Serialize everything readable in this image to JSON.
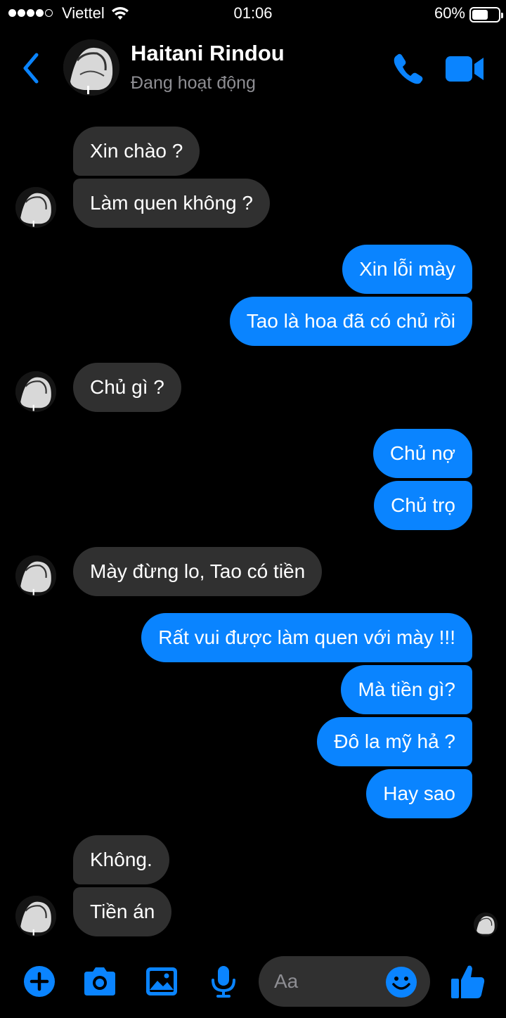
{
  "status_bar": {
    "carrier": "Viettel",
    "time": "01:06",
    "battery_percent": "60%",
    "battery_level": 0.6
  },
  "header": {
    "contact_name": "Haitani Rindou",
    "contact_status": "Đang hoạt động",
    "icons": [
      "back-chevron-icon",
      "phone-icon",
      "video-camera-icon"
    ]
  },
  "messages": [
    {
      "sender": "them",
      "text": "Xin chào ?"
    },
    {
      "sender": "them",
      "text": "Làm quen không ?"
    },
    {
      "sender": "me",
      "text": "Xin lỗi mày"
    },
    {
      "sender": "me",
      "text": "Tao là hoa đã có chủ rồi"
    },
    {
      "sender": "them",
      "text": "Chủ gì ?"
    },
    {
      "sender": "me",
      "text": "Chủ nợ"
    },
    {
      "sender": "me",
      "text": "Chủ trọ"
    },
    {
      "sender": "them",
      "text": "Mày đừng lo, Tao có tiền"
    },
    {
      "sender": "me",
      "text": "Rất vui được làm quen với mày !!!"
    },
    {
      "sender": "me",
      "text": "Mà tiền gì?"
    },
    {
      "sender": "me",
      "text": "Đô la mỹ hả ?"
    },
    {
      "sender": "me",
      "text": "Hay sao"
    },
    {
      "sender": "them",
      "text": "Không."
    },
    {
      "sender": "them",
      "text": "Tiền án"
    }
  ],
  "composer": {
    "placeholder": "Aa",
    "icons": [
      "plus-icon",
      "camera-icon",
      "image-icon",
      "microphone-icon",
      "emoji-icon",
      "thumbs-up-icon"
    ]
  },
  "colors": {
    "accent": "#0a84ff",
    "incoming_bubble": "#303030",
    "background": "#000000",
    "secondary_text": "#8e8e93"
  }
}
